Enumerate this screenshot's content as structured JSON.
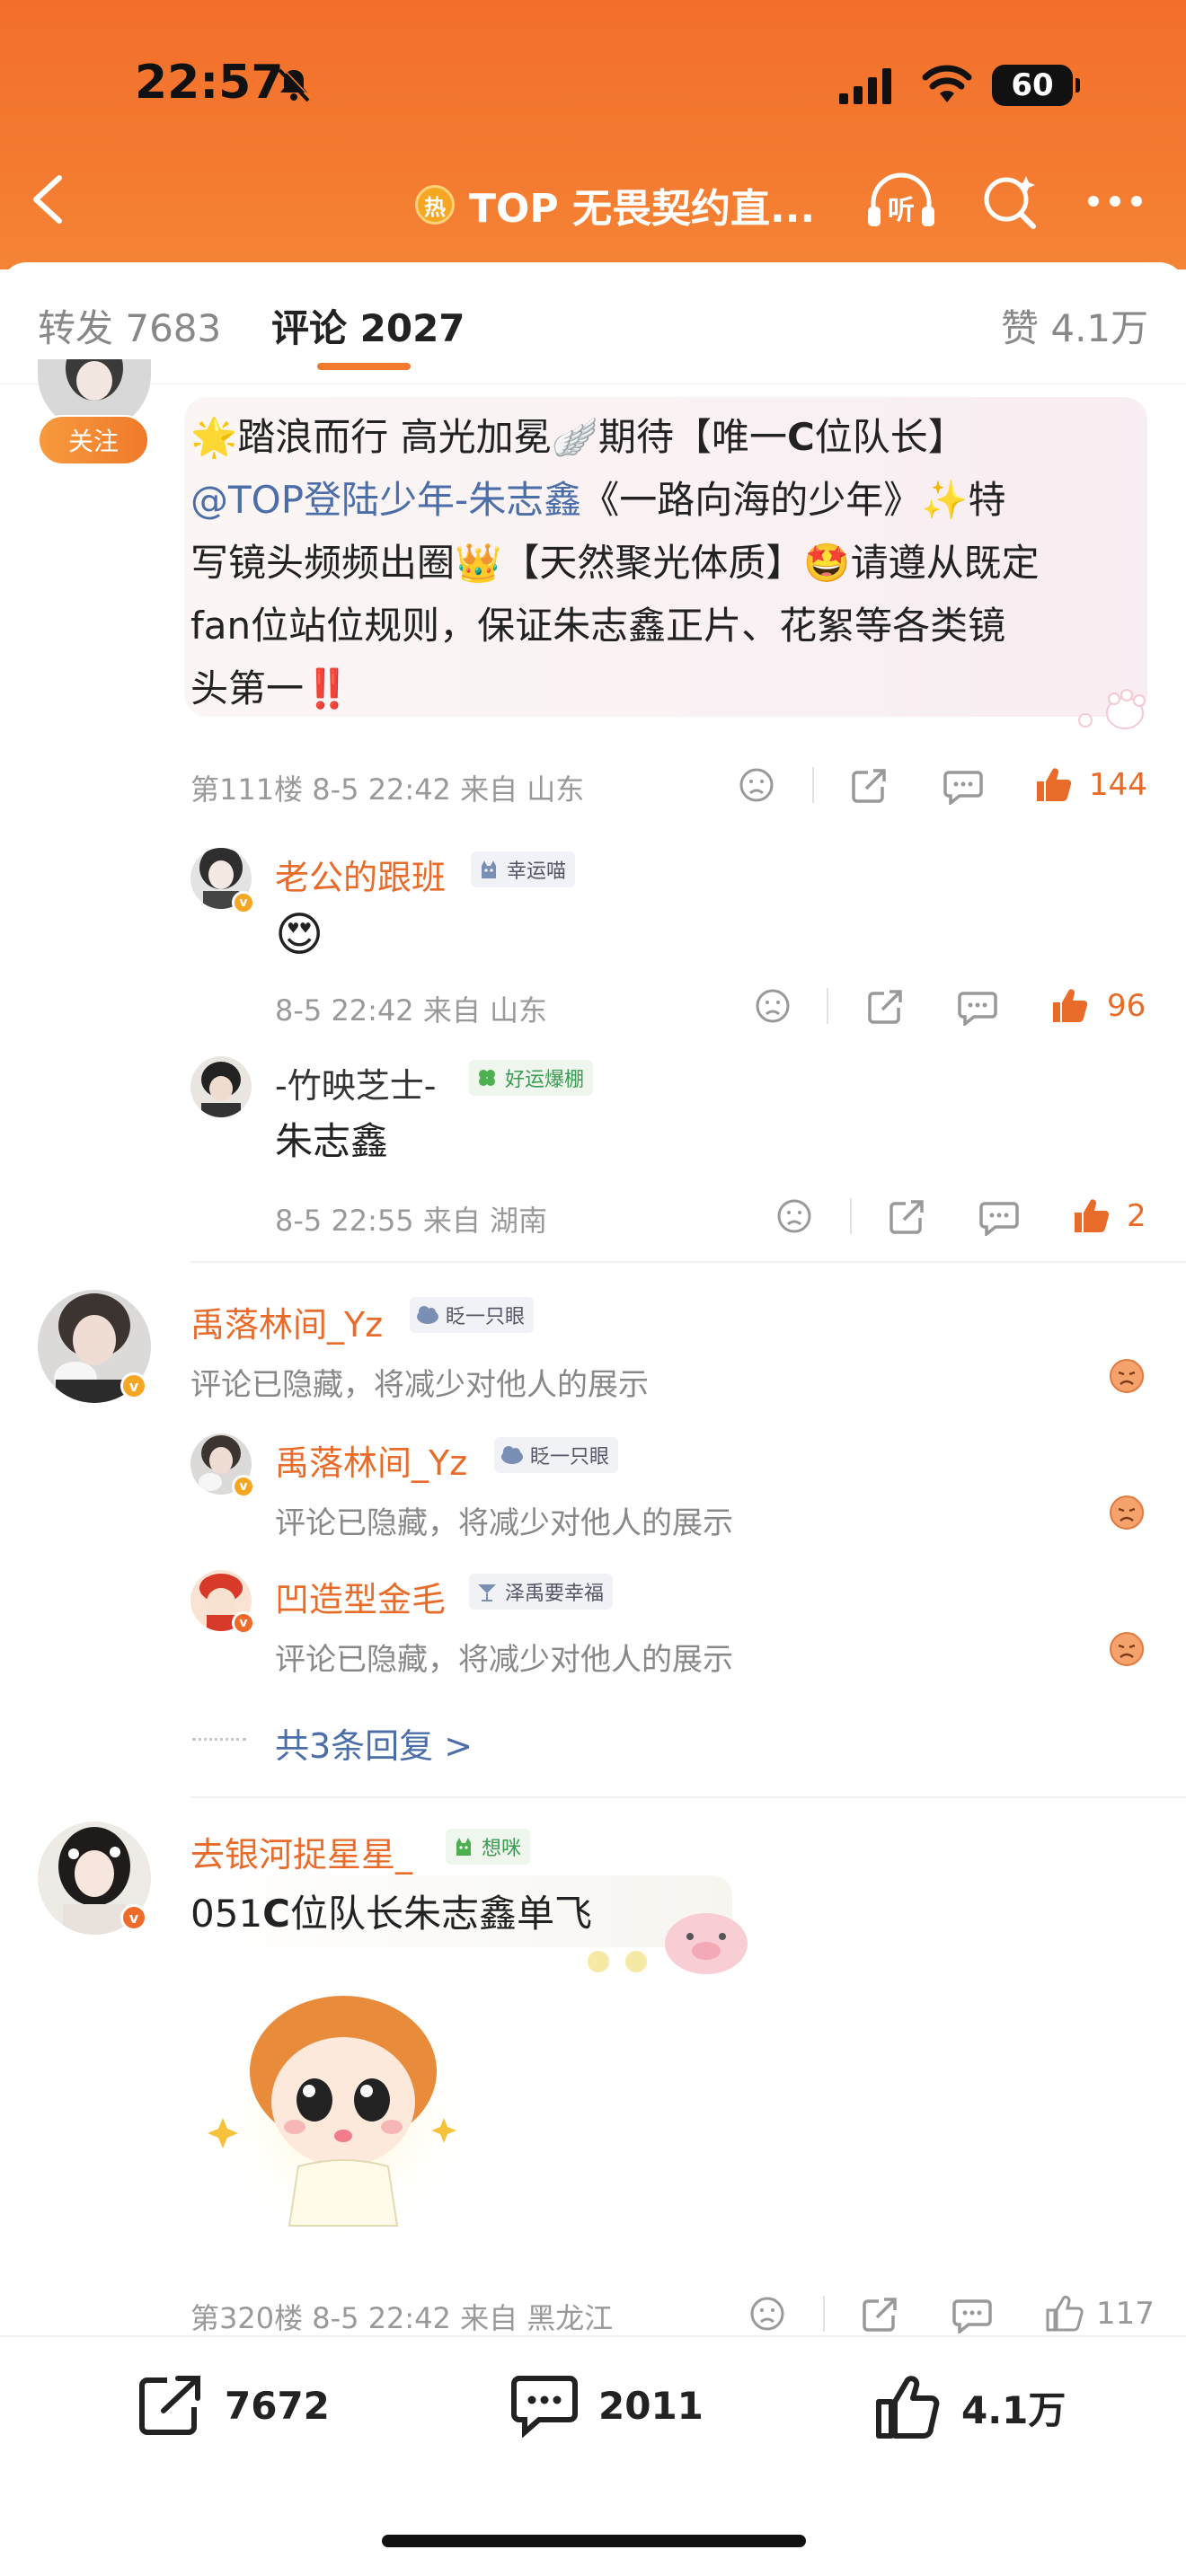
{
  "status": {
    "time": "22:57",
    "battery": "60"
  },
  "nav": {
    "hot_label": "热",
    "title": "TOP 无畏契约直..."
  },
  "tabs": {
    "repost": "转发 7683",
    "comments": "评论 2027",
    "likes": "赞 4.1万"
  },
  "comment1": {
    "follow_label": "关注",
    "lines": [
      {
        "a": "踏浪而行 高光加冕",
        "b": "期待【唯一",
        "c": "C",
        "d": "位队长】"
      },
      {
        "mention": "@TOP登陆少年-朱志鑫",
        "rest": "《一路向海的少年》",
        "tail": "特"
      },
      {
        "a": "写镜头频频出圈",
        "b": "【天然聚光体质】",
        "c": "请遵从既定"
      },
      {
        "a": "fan位站位规则，保证朱志鑫正片、花絮等各类镜"
      },
      {
        "a": "头第一",
        "red": "‼️"
      }
    ],
    "meta": "第111楼  8-5 22:42  来自 山东",
    "likes": "144"
  },
  "reply1": {
    "username": "老公的跟班",
    "badge": "幸运喵",
    "meta": "8-5 22:42  来自 山东",
    "likes": "96"
  },
  "reply2": {
    "username": "-竹映芝士-",
    "badge": "好运爆棚",
    "text": "朱志鑫",
    "meta": "8-5 22:55  来自 湖南",
    "likes": "2"
  },
  "comment2": {
    "username": "禹落林间_Yz",
    "badge": "眨一只眼",
    "hidden": "评论已隐藏，将减少对他人的展示",
    "replies": [
      {
        "username": "禹落林间_Yz",
        "badge": "眨一只眼",
        "hidden": "评论已隐藏，将减少对他人的展示"
      },
      {
        "username": "凹造型金毛",
        "badge": "泽禹要幸福",
        "hidden": "评论已隐藏，将减少对他人的展示"
      }
    ],
    "more": "共3条回复 >"
  },
  "comment3": {
    "username": "去银河捉星星_",
    "badge": "想咪",
    "text_a": "051",
    "text_c": "C",
    "text_b": "位队长朱志鑫单飞",
    "meta": "第320楼  8-5 22:42  来自 黑龙江",
    "likes": "117"
  },
  "bottom": {
    "repost": "7672",
    "comment": "2011",
    "like": "4.1万"
  },
  "colors": {
    "accent": "#f47a30",
    "link": "#4b6ea8",
    "username": "#e86b2a"
  }
}
